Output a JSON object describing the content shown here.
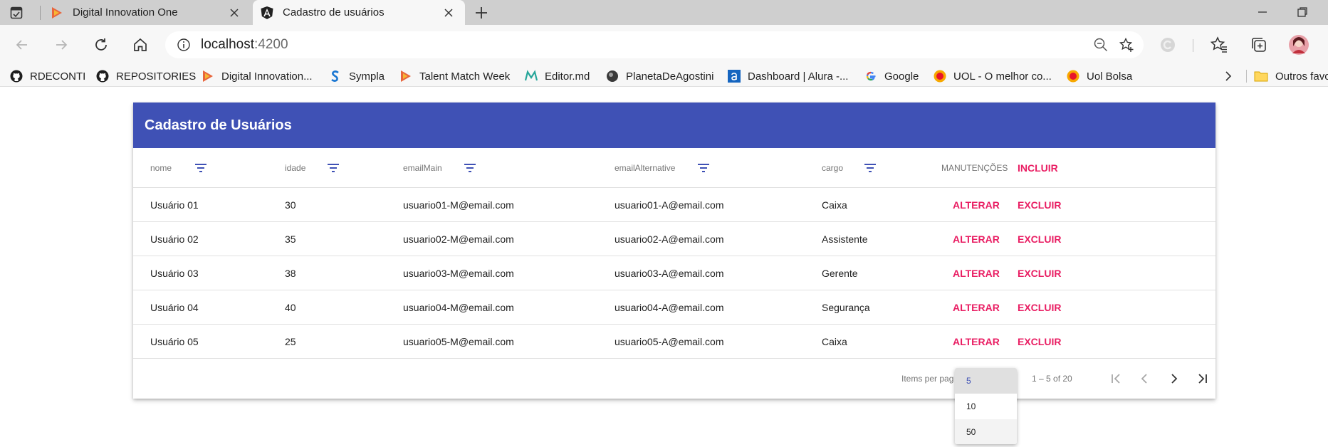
{
  "browser": {
    "tabs": [
      {
        "title": "Digital Innovation One",
        "active": false
      },
      {
        "title": "Cadastro de usuários",
        "active": true
      }
    ],
    "url_host": "localhost",
    "url_port": ":4200"
  },
  "bookmarks": [
    {
      "label": "RDECONTI",
      "icon": "github-icon"
    },
    {
      "label": "REPOSITORIES",
      "icon": "github-icon"
    },
    {
      "label": "Digital Innovation...",
      "icon": "dio-icon"
    },
    {
      "label": "Sympla",
      "icon": "sympla-icon"
    },
    {
      "label": "Talent Match Week",
      "icon": "dio-icon"
    },
    {
      "label": "Editor.md",
      "icon": "editormd-icon"
    },
    {
      "label": "PlanetaDeAgostini",
      "icon": "planeta-icon"
    },
    {
      "label": "Dashboard | Alura -...",
      "icon": "alura-icon"
    },
    {
      "label": "Google",
      "icon": "google-icon"
    },
    {
      "label": "UOL - O melhor co...",
      "icon": "uol-icon"
    },
    {
      "label": "Uol Bolsa",
      "icon": "uol-icon"
    },
    {
      "label": "Outros favo",
      "icon": "folder-icon"
    }
  ],
  "page": {
    "title": "Cadastro de Usuários",
    "columns": {
      "nome": "nome",
      "idade": "idade",
      "emailMain": "emailMain",
      "emailAlternative": "emailAlternative",
      "cargo": "cargo",
      "manutencoes": "MANUTENÇÕES",
      "incluir": "INCLUIR"
    },
    "rows": [
      {
        "nome": "Usuário 01",
        "idade": "30",
        "emailMain": "usuario01-M@email.com",
        "emailAlternative": "usuario01-A@email.com",
        "cargo": "Caixa"
      },
      {
        "nome": "Usuário 02",
        "idade": "35",
        "emailMain": "usuario02-M@email.com",
        "emailAlternative": "usuario02-A@email.com",
        "cargo": "Assistente"
      },
      {
        "nome": "Usuário 03",
        "idade": "38",
        "emailMain": "usuario03-M@email.com",
        "emailAlternative": "usuario03-A@email.com",
        "cargo": "Gerente"
      },
      {
        "nome": "Usuário 04",
        "idade": "40",
        "emailMain": "usuario04-M@email.com",
        "emailAlternative": "usuario04-A@email.com",
        "cargo": "Segurança"
      },
      {
        "nome": "Usuário 05",
        "idade": "25",
        "emailMain": "usuario05-M@email.com",
        "emailAlternative": "usuario05-A@email.com",
        "cargo": "Caixa"
      }
    ],
    "actions": {
      "alterar": "ALTERAR",
      "excluir": "EXCLUIR"
    },
    "paginator": {
      "items_per_page_label": "Items per pag",
      "range": "1 – 5 of 20",
      "page_size_options": [
        "5",
        "10",
        "50"
      ],
      "selected_page_size": "5"
    }
  },
  "colors": {
    "primary": "#3f51b5",
    "accent": "#e91e63"
  }
}
